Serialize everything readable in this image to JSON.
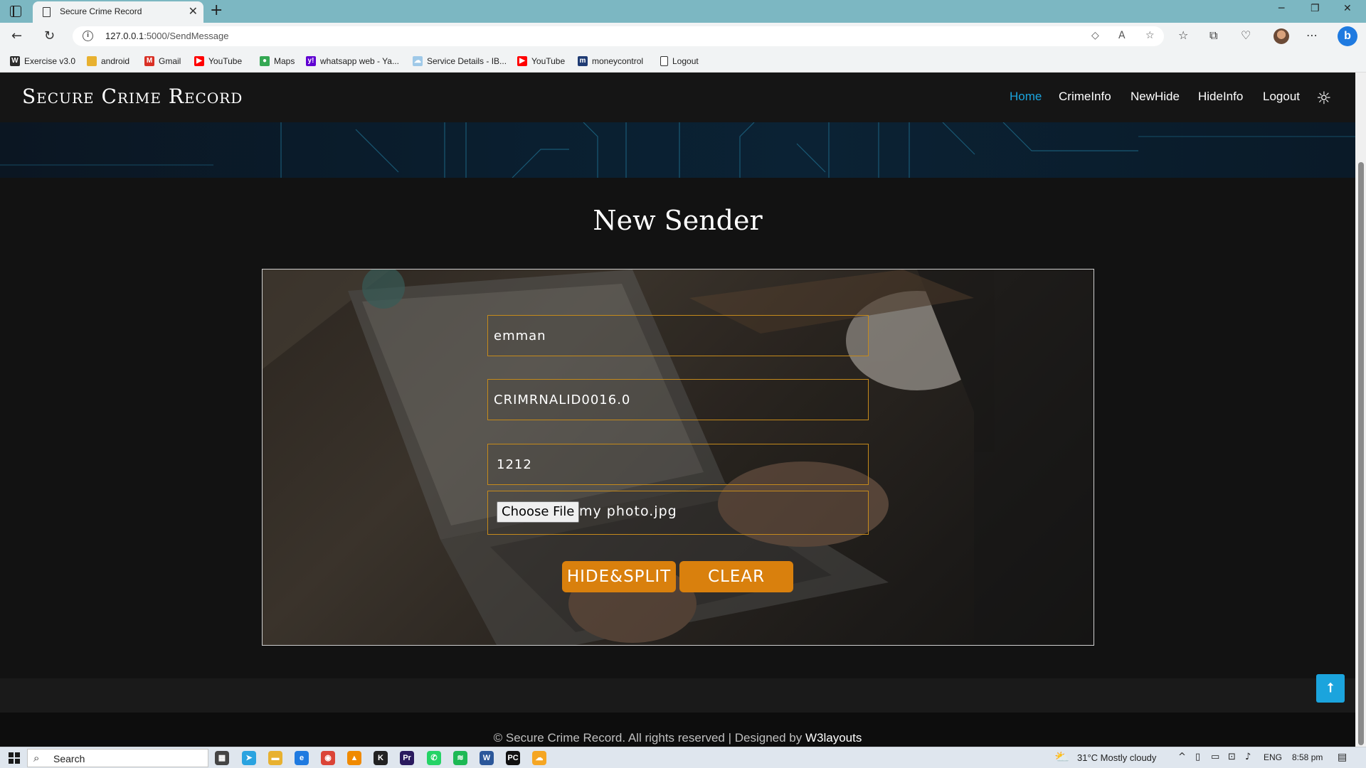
{
  "browser": {
    "tab_title": "Secure Crime Record",
    "tab_close": "✕",
    "new_tab": "+",
    "url_host": "127.0.0.1",
    "url_path": ":5000/SendMessage",
    "window_controls": {
      "minimize": "─",
      "restore": "❐",
      "close": "✕"
    },
    "nav": {
      "back": "←",
      "reload": "↻"
    },
    "toolbar_icons": [
      "read-aloud-icon",
      "favorites-add-icon",
      "favorites-icon",
      "collections-icon",
      "extensions-icon",
      "profile-icon",
      "more-icon",
      "bing-icon"
    ],
    "more_label": "⋯",
    "bing_label": "b"
  },
  "bookmarks": [
    {
      "label": "Exercise v3.0",
      "icon": "W",
      "color": "#2b2b2b"
    },
    {
      "label": "android",
      "icon": "",
      "color": "#e8b130"
    },
    {
      "label": "Gmail",
      "icon": "M",
      "color": "#d93025"
    },
    {
      "label": "YouTube",
      "icon": "▶",
      "color": "#ff0000"
    },
    {
      "label": "Maps",
      "icon": "●",
      "color": "#34a853"
    },
    {
      "label": "whatsapp web - Ya...",
      "icon": "y!",
      "color": "#6001d2"
    },
    {
      "label": "Service Details - IB...",
      "icon": "☁",
      "color": "#9fc9e8"
    },
    {
      "label": "YouTube",
      "icon": "▶",
      "color": "#ff0000"
    },
    {
      "label": "moneycontrol",
      "icon": "m",
      "color": "#1f3b73"
    },
    {
      "label": "Logout",
      "icon": "",
      "color": "#ffffff"
    }
  ],
  "site": {
    "brand": "Secure Crime Record",
    "nav": [
      {
        "label": "Home",
        "active": true
      },
      {
        "label": "CrimeInfo",
        "active": false
      },
      {
        "label": "NewHide",
        "active": false
      },
      {
        "label": "HideInfo",
        "active": false
      },
      {
        "label": "Logout",
        "active": false
      }
    ],
    "theme_toggle": "☼",
    "page_title": "New Sender",
    "form": {
      "field1_value": "emman",
      "field2_value": "CRIMRNALID0016.0",
      "field3_value": "1212",
      "file_button": "Choose File",
      "file_name": "my photo.jpg",
      "submit_label": "HIDE&SPLIT",
      "clear_label": "CLEAR"
    },
    "footer": {
      "text": "© Secure Crime Record. All rights reserved | Designed by ",
      "link": "W3layouts"
    },
    "scroll_top": "⭡",
    "accent_color": "#1ba4dd",
    "button_color": "#d9800d"
  },
  "taskbar": {
    "search_label": "Search",
    "weather": "31°C  Mostly cloudy",
    "language": "ENG",
    "time": "8:58 pm",
    "apps": [
      {
        "name": "task-view-icon",
        "glyph": "▦",
        "color": "#444"
      },
      {
        "name": "telegram-icon",
        "glyph": "➤",
        "color": "#2aa3e0"
      },
      {
        "name": "file-explorer-icon",
        "glyph": "▬",
        "color": "#e8b130"
      },
      {
        "name": "edge-icon",
        "glyph": "e",
        "color": "#1f7ae0"
      },
      {
        "name": "chrome-icon",
        "glyph": "◉",
        "color": "#db4437"
      },
      {
        "name": "vlc-icon",
        "glyph": "▲",
        "color": "#f08a00"
      },
      {
        "name": "kali-icon",
        "glyph": "K",
        "color": "#222"
      },
      {
        "name": "premiere-icon",
        "glyph": "Pr",
        "color": "#2a1a5e"
      },
      {
        "name": "whatsapp-icon",
        "glyph": "✆",
        "color": "#25d366"
      },
      {
        "name": "spotify-icon",
        "glyph": "≋",
        "color": "#1db954"
      },
      {
        "name": "word-icon",
        "glyph": "W",
        "color": "#2b579a"
      },
      {
        "name": "pycharm-icon",
        "glyph": "PC",
        "color": "#111"
      },
      {
        "name": "onedrive-icon",
        "glyph": "☁",
        "color": "#f5a623"
      }
    ]
  }
}
